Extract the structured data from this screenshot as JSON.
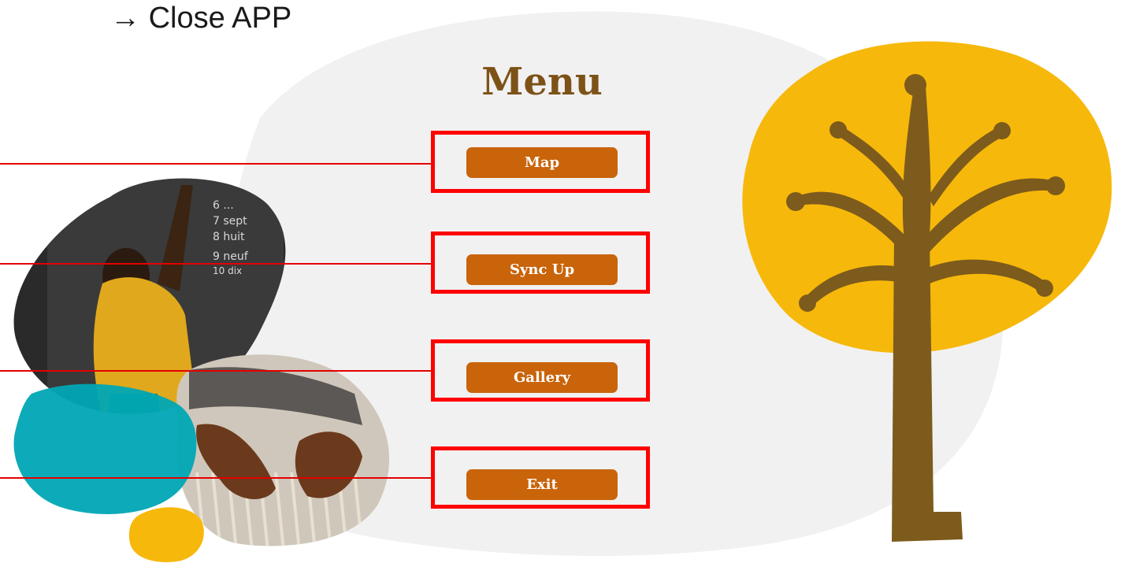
{
  "annotation": {
    "arrow": "→",
    "label": "Close APP"
  },
  "menu": {
    "title": "Menu",
    "buttons": [
      {
        "label": "Map"
      },
      {
        "label": "Sync Up"
      },
      {
        "label": "Gallery"
      },
      {
        "label": "Exit"
      }
    ]
  },
  "colors": {
    "title": "#7d5217",
    "button": "#c9640a",
    "highlight": "#ff0000",
    "tree_canopy": "#f6b80b",
    "tree_trunk": "#7d5b1c",
    "teal_blob": "#00a7b5",
    "page_blob": "#f1f1f1"
  },
  "decorations": {
    "tree": "tree-of-hands-icon",
    "photo_blackboard": "child-at-blackboard-photo",
    "photo_weaving": "hands-weaving-photo"
  }
}
